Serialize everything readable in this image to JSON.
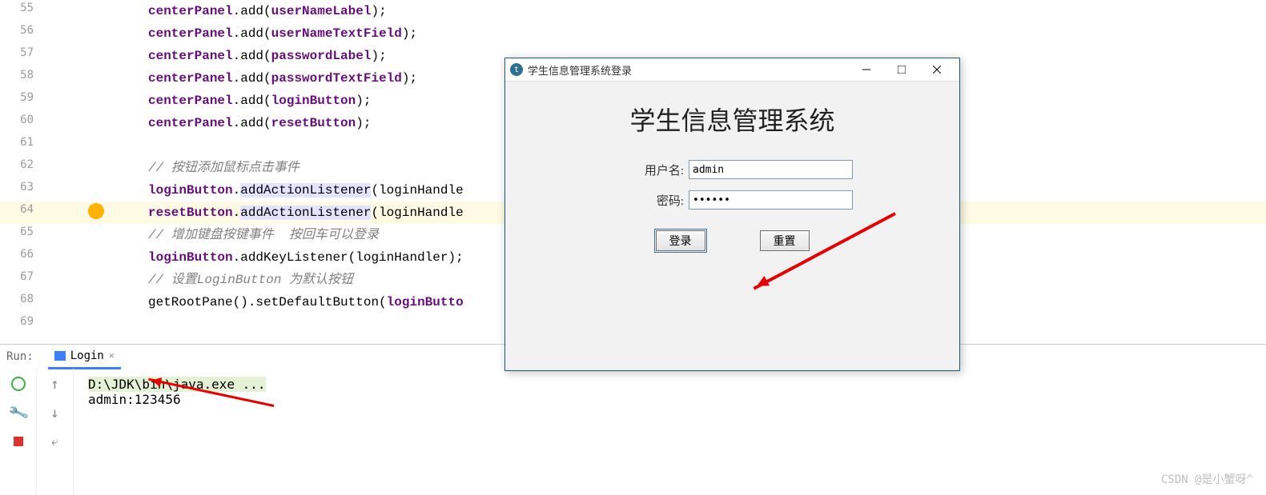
{
  "editor": {
    "lines": [
      {
        "num": 55,
        "segs": [
          {
            "t": "centerPanel",
            "c": "purple"
          },
          {
            "t": ".add(",
            "c": "black"
          },
          {
            "t": "userNameLabel",
            "c": "purple"
          },
          {
            "t": ");",
            "c": "black"
          }
        ]
      },
      {
        "num": 56,
        "segs": [
          {
            "t": "centerPanel",
            "c": "purple"
          },
          {
            "t": ".add(",
            "c": "black"
          },
          {
            "t": "userNameTextField",
            "c": "purple"
          },
          {
            "t": ");",
            "c": "black"
          }
        ]
      },
      {
        "num": 57,
        "segs": [
          {
            "t": "centerPanel",
            "c": "purple"
          },
          {
            "t": ".add(",
            "c": "black"
          },
          {
            "t": "passwordLabel",
            "c": "purple"
          },
          {
            "t": ");",
            "c": "black"
          }
        ]
      },
      {
        "num": 58,
        "segs": [
          {
            "t": "centerPanel",
            "c": "purple"
          },
          {
            "t": ".add(",
            "c": "black"
          },
          {
            "t": "passwordTextField",
            "c": "purple"
          },
          {
            "t": ");",
            "c": "black"
          }
        ]
      },
      {
        "num": 59,
        "segs": [
          {
            "t": "centerPanel",
            "c": "purple"
          },
          {
            "t": ".add(",
            "c": "black"
          },
          {
            "t": "loginButton",
            "c": "purple"
          },
          {
            "t": ");",
            "c": "black"
          }
        ]
      },
      {
        "num": 60,
        "segs": [
          {
            "t": "centerPanel",
            "c": "purple"
          },
          {
            "t": ".add(",
            "c": "black"
          },
          {
            "t": "resetButton",
            "c": "purple"
          },
          {
            "t": ");",
            "c": "black"
          }
        ]
      },
      {
        "num": 61,
        "segs": []
      },
      {
        "num": 62,
        "segs": [
          {
            "t": "// 按钮添加鼠标点击事件",
            "c": "comment"
          }
        ]
      },
      {
        "num": 63,
        "segs": [
          {
            "t": "loginButton",
            "c": "purple"
          },
          {
            "t": ".",
            "c": "black"
          },
          {
            "t": "addActionListener",
            "c": "black yellow-sel"
          },
          {
            "t": "(loginHandle",
            "c": "black"
          }
        ]
      },
      {
        "num": 64,
        "segs": [
          {
            "t": "resetButton",
            "c": "purple"
          },
          {
            "t": ".",
            "c": "black"
          },
          {
            "t": "addActionListener",
            "c": "black yellow-sel"
          },
          {
            "t": "(loginHandle",
            "c": "black"
          }
        ]
      },
      {
        "num": 65,
        "segs": [
          {
            "t": "// 增加键盘按键事件  按回车可以登录",
            "c": "comment"
          }
        ]
      },
      {
        "num": 66,
        "segs": [
          {
            "t": "loginButton",
            "c": "purple"
          },
          {
            "t": ".addKeyListener(loginHandler);",
            "c": "black"
          }
        ]
      },
      {
        "num": 67,
        "segs": [
          {
            "t": "// 设置LoginButton 为默认按钮",
            "c": "comment"
          }
        ]
      },
      {
        "num": 68,
        "segs": [
          {
            "t": "getRootPane().setDefaultButton(",
            "c": "black"
          },
          {
            "t": "loginButto",
            "c": "purple"
          }
        ]
      },
      {
        "num": 69,
        "segs": []
      }
    ],
    "highlight_line": 64
  },
  "run": {
    "label": "Run:",
    "tab": "Login",
    "console_lines": [
      "D:\\JDK\\bin\\java.exe ...",
      "admin:123456"
    ]
  },
  "dialog": {
    "window_title": "学生信息管理系统登录",
    "heading": "学生信息管理系统",
    "username_label": "用户名:",
    "username_value": "admin",
    "password_label": "密码:",
    "password_value": "123456",
    "login_btn": "登录",
    "reset_btn": "重置"
  },
  "watermark": "CSDN @是小蟹呀^"
}
